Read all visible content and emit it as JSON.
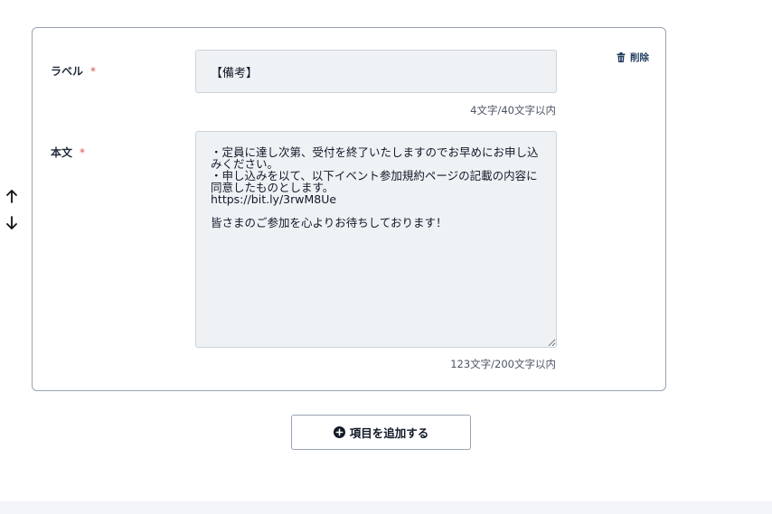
{
  "label_field": {
    "label": "ラベル",
    "required_mark": "*",
    "value": "【備考】",
    "counter": "4文字/40文字以内"
  },
  "body_field": {
    "label": "本文",
    "required_mark": "*",
    "value": "・定員に達し次第、受付を終了いたしますのでお早めにお申し込みください。\n・申し込みを以て、以下イベント参加規約ページの記載の内容に同意したものとします。\nhttps://bit.ly/3rwM8Ue\n\n皆さまのご参加を心よりお待ちしております！",
    "counter": "123文字/200文字以内"
  },
  "delete_button": {
    "label": "削除",
    "icon": "trash-icon"
  },
  "add_item_button": {
    "label": "項目を追加する",
    "icon": "plus-circle-icon"
  },
  "move_controls": {
    "up_icon": "arrow-up-icon",
    "down_icon": "arrow-down-icon"
  },
  "colors": {
    "required": "#d9534f",
    "input_bg": "#eff2f5",
    "border": "#9aa3b5",
    "delete_text": "#1e3a5f"
  }
}
